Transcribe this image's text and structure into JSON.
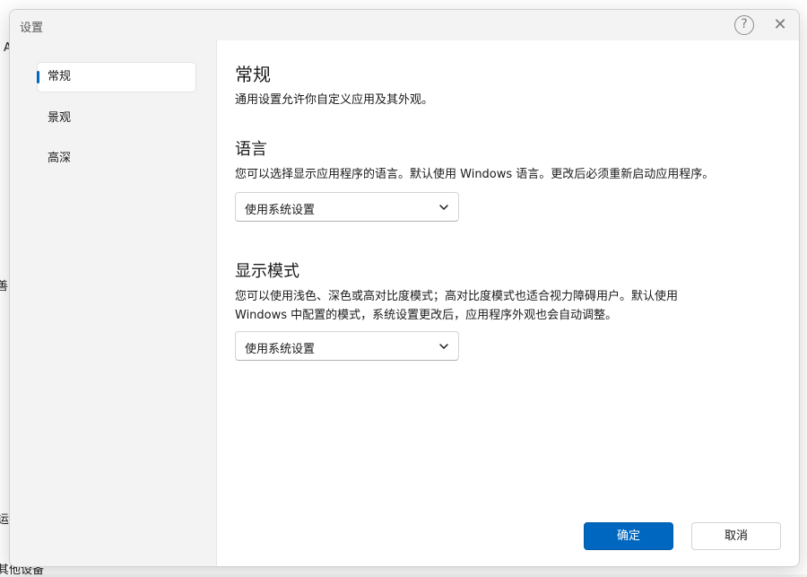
{
  "dialog": {
    "title": "设置",
    "help_icon": "question-mark-icon",
    "help_glyph": "?",
    "close_icon": "close-icon",
    "close_glyph": "✕"
  },
  "sidebar": {
    "items": [
      {
        "label": "常规",
        "active": true
      },
      {
        "label": "景观",
        "active": false
      },
      {
        "label": "高深",
        "active": false
      }
    ]
  },
  "main": {
    "title": "常规",
    "description": "通用设置允许你自定义应用及其外观。",
    "language": {
      "heading": "语言",
      "description": "您可以选择显示应用程序的语言。默认使用 Windows 语言。更改后必须重新启动应用程序。",
      "selected": "使用系统设置"
    },
    "display_mode": {
      "heading": "显示模式",
      "description_line1": "您可以使用浅色、深色或高对比度模式；高对比度模式也适合视力障碍用户。默认使用",
      "description_line2": "Windows 中配置的模式，系统设置更改后，应用程序外观也会自动调整。",
      "selected": "使用系统设置"
    }
  },
  "footer": {
    "ok_label": "确定",
    "cancel_label": "取消"
  },
  "background": {
    "fragment_a": "A",
    "fragment_b": "善",
    "fragment_c": "运",
    "fragment_d": "其他设备"
  },
  "colors": {
    "accent": "#0067c0",
    "sidebar_bg": "#f3f3f3"
  }
}
